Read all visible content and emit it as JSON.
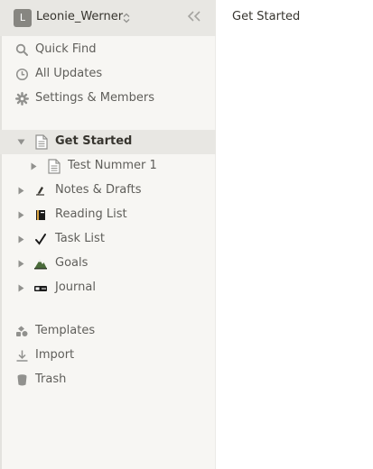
{
  "workspace": {
    "avatar_letter": "L",
    "name": "Leonie_Werner"
  },
  "nav": {
    "quick_find": "Quick Find",
    "all_updates": "All Updates",
    "settings": "Settings & Members"
  },
  "pages": [
    {
      "label": "Get Started",
      "icon": "page-icon",
      "expanded": true,
      "active": true
    },
    {
      "label": "Test Nummer 1",
      "icon": "page-icon",
      "expanded": false,
      "active": false
    },
    {
      "label": "Notes & Drafts",
      "icon": "pen-icon",
      "expanded": false,
      "active": false
    },
    {
      "label": "Reading List",
      "icon": "book-icon",
      "expanded": false,
      "active": false
    },
    {
      "label": "Task List",
      "icon": "check-icon",
      "expanded": false,
      "active": false
    },
    {
      "label": "Goals",
      "icon": "mountain-icon",
      "expanded": false,
      "active": false
    },
    {
      "label": "Journal",
      "icon": "notebook-icon",
      "expanded": false,
      "active": false
    }
  ],
  "footer": {
    "templates": "Templates",
    "import": "Import",
    "trash": "Trash"
  },
  "main": {
    "title": "Get Started"
  },
  "colors": {
    "sidebar_bg": "#f7f6f3",
    "active_bg": "#e8e7e3",
    "text": "#37352f",
    "muted_text": "#5f5e5a",
    "icon": "#91918e"
  }
}
